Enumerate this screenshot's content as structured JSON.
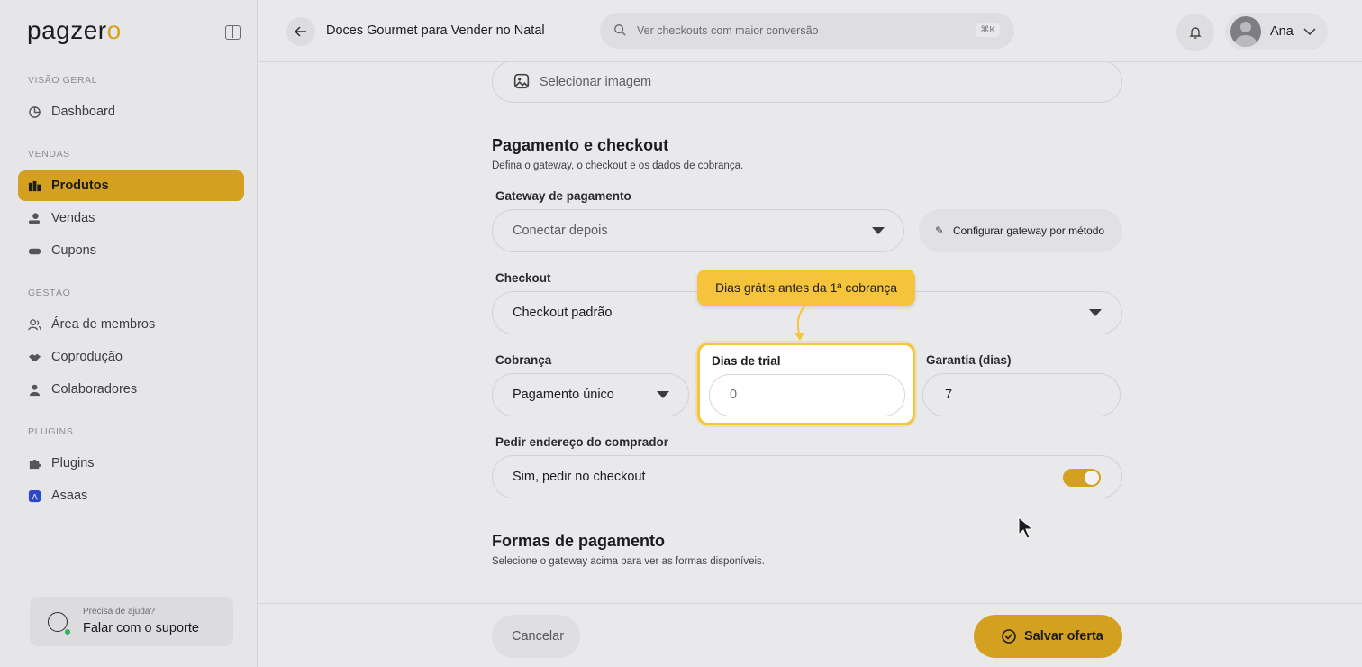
{
  "brand": {
    "logo_text": "pagzer",
    "logo_accent": "o",
    "accent_color": "#d4a020"
  },
  "sidebar": {
    "sections": [
      {
        "label": "VISÃO GERAL"
      },
      {
        "label": "VENDAS"
      },
      {
        "label": "GESTÃO"
      },
      {
        "label": "PLUGINS"
      }
    ],
    "items": [
      {
        "label": "Dashboard",
        "icon": "chart-pie-icon"
      },
      {
        "label": "Produtos",
        "icon": "boxes-icon",
        "active": true
      },
      {
        "label": "Vendas",
        "icon": "hand-coin-icon"
      },
      {
        "label": "Cupons",
        "icon": "ticket-icon"
      },
      {
        "label": "Área de membros",
        "icon": "users-icon"
      },
      {
        "label": "Coprodução",
        "icon": "handshake-icon"
      },
      {
        "label": "Colaboradores",
        "icon": "user-icon"
      },
      {
        "label": "Plugins",
        "icon": "puzzle-icon"
      },
      {
        "label": "Asaas",
        "icon": "asaas-logo-icon"
      }
    ],
    "help": {
      "small": "Precisa de ajuda?",
      "main": "Falar com o suporte"
    }
  },
  "header": {
    "title": "Doces Gourmet para Vender no Natal",
    "search_placeholder": "Ver checkouts com maior conversão",
    "search_shortcut": "⌘K",
    "user_name": "Ana"
  },
  "form": {
    "image_button": "Selecionar imagem",
    "payment_section": {
      "title": "Pagamento e checkout",
      "subtitle": "Defina o gateway, o checkout e os dados de cobrança."
    },
    "gateway_label": "Gateway de pagamento",
    "gateway_value": "Conectar depois",
    "gateway_config_button": "Configurar gateway por método",
    "checkout_label": "Checkout",
    "checkout_value": "Checkout padrão",
    "billing_label": "Cobrança",
    "billing_value": "Pagamento único",
    "trial_label": "Dias de trial",
    "trial_value": "0",
    "warranty_label": "Garantia (dias)",
    "warranty_value": "7",
    "address_label": "Pedir endereço do comprador",
    "address_value": "Sim, pedir no checkout",
    "address_toggle_on": true,
    "methods_section": {
      "title": "Formas de pagamento",
      "subtitle": "Selecione o gateway acima para ver as formas disponíveis."
    }
  },
  "tooltip": {
    "text": "Dias grátis antes da 1ª cobrança"
  },
  "footer": {
    "cancel_label": "Cancelar",
    "save_label": "Salvar oferta"
  }
}
